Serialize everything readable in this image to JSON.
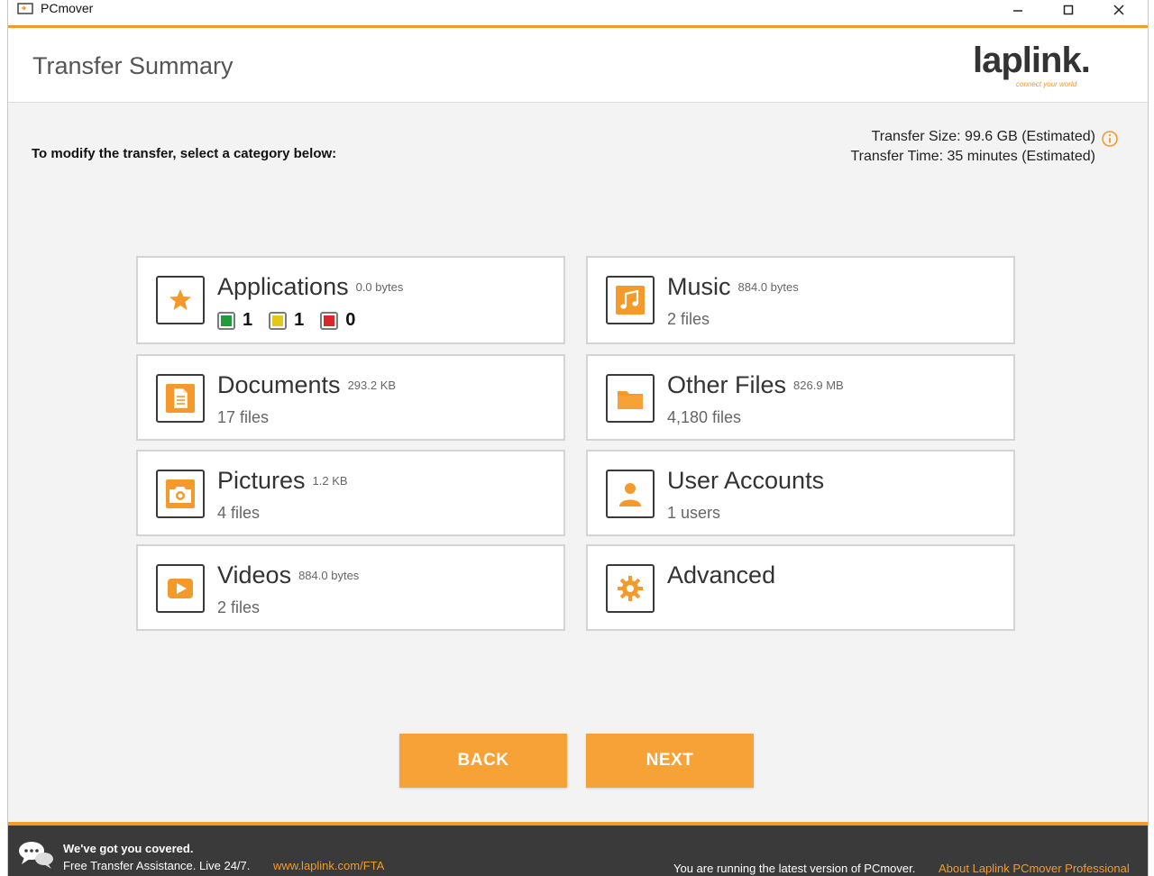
{
  "window": {
    "title": "PCmover",
    "controls": {
      "minimize": "–",
      "maximize": "☐",
      "close": "✕"
    }
  },
  "header": {
    "title": "Transfer Summary",
    "logo_text": "laplink.",
    "logo_tagline": "connect your world"
  },
  "instruction": "To modify the transfer, select a category below:",
  "transfer": {
    "size_line": "Transfer Size: 99.6 GB (Estimated)",
    "time_line": "Transfer Time: 35 minutes (Estimated)"
  },
  "categories": {
    "applications": {
      "title": "Applications",
      "size": "0.0 bytes",
      "green": "1",
      "yellow": "1",
      "red": "0"
    },
    "music": {
      "title": "Music",
      "size": "884.0 bytes",
      "detail": "2 files"
    },
    "documents": {
      "title": "Documents",
      "size": "293.2 KB",
      "detail": "17 files"
    },
    "other_files": {
      "title": "Other Files",
      "size": "826.9 MB",
      "detail": "4,180 files"
    },
    "pictures": {
      "title": "Pictures",
      "size": "1.2 KB",
      "detail": "4 files"
    },
    "user_accounts": {
      "title": "User Accounts",
      "detail": "1 users"
    },
    "videos": {
      "title": "Videos",
      "size": "884.0 bytes",
      "detail": "2 files"
    },
    "advanced": {
      "title": "Advanced"
    }
  },
  "buttons": {
    "back": "BACK",
    "next": "NEXT"
  },
  "footer": {
    "line1": "We've got you covered.",
    "line2": "Free Transfer Assistance. Live 24/7.",
    "link": "www.laplink.com/FTA",
    "version_note": "You are running the latest version of PCmover.",
    "about_link": "About Laplink PCmover Professional"
  },
  "colors": {
    "accent": "#f39a2b",
    "button": "#f7a236",
    "status_green": "#1f9d3a",
    "status_yellow": "#e6c619",
    "status_red": "#d9262b"
  }
}
